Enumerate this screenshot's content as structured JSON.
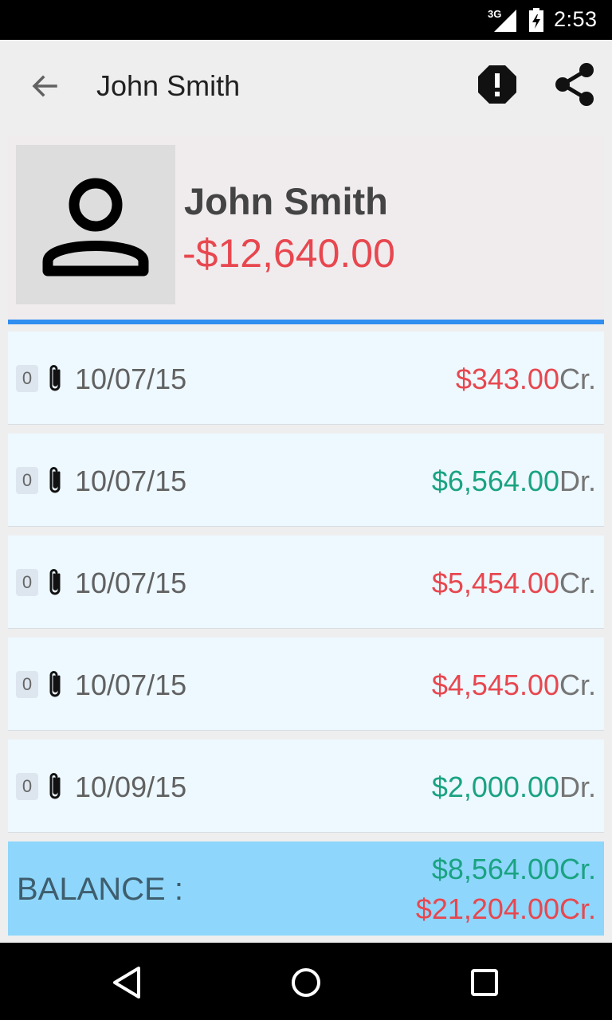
{
  "status_bar": {
    "network": "3G",
    "time": "2:53"
  },
  "app_bar": {
    "title": "John Smith"
  },
  "profile": {
    "name": "John Smith",
    "amount": "-$12,640.00"
  },
  "transactions": [
    {
      "badge": "0",
      "date": "10/07/15",
      "amount": "$343.00",
      "type": "Cr.",
      "color": "#e8474f"
    },
    {
      "badge": "0",
      "date": "10/07/15",
      "amount": "$6,564.00",
      "type": "Dr.",
      "color": "#1aa382"
    },
    {
      "badge": "0",
      "date": "10/07/15",
      "amount": "$5,454.00",
      "type": "Cr.",
      "color": "#e8474f"
    },
    {
      "badge": "0",
      "date": "10/07/15",
      "amount": "$4,545.00",
      "type": "Cr.",
      "color": "#e8474f"
    },
    {
      "badge": "0",
      "date": "10/09/15",
      "amount": "$2,000.00",
      "type": "Dr.",
      "color": "#1aa382"
    }
  ],
  "balance": {
    "label": "BALANCE :",
    "credit_green": "$8,564.00Cr.",
    "credit_red": "$21,204.00Cr."
  },
  "colors": {
    "accent_blue": "#2f8ef0",
    "credit_red": "#e8474f",
    "debit_green": "#1aa382",
    "balance_bg": "#8ed6fb"
  },
  "icons": [
    "back-arrow-icon",
    "alert-icon",
    "share-icon",
    "avatar-person-icon",
    "paperclip-icon",
    "nav-back-icon",
    "nav-home-icon",
    "nav-recents-icon"
  ]
}
